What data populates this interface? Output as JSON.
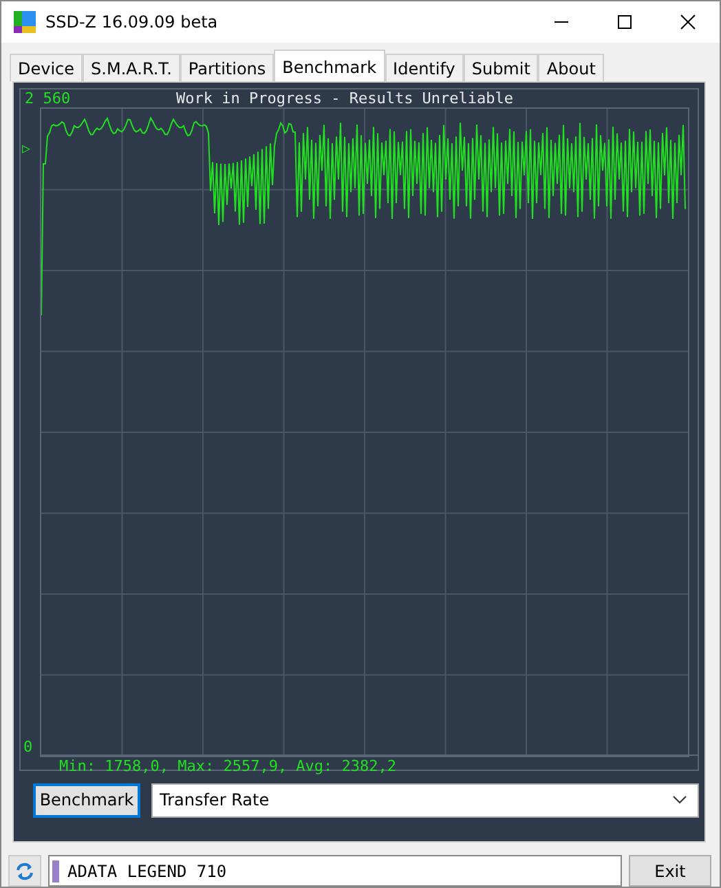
{
  "window": {
    "title": "SSD-Z 16.09.09 beta"
  },
  "tabs": [
    {
      "label": "Device",
      "selected": false
    },
    {
      "label": "S.M.A.R.T.",
      "selected": false
    },
    {
      "label": "Partitions",
      "selected": false
    },
    {
      "label": "Benchmark",
      "selected": true
    },
    {
      "label": "Identify",
      "selected": false
    },
    {
      "label": "Submit",
      "selected": false
    },
    {
      "label": "About",
      "selected": false
    }
  ],
  "graph": {
    "title": "Work in Progress - Results Unreliable",
    "y_max_label": "2 560",
    "y_min_label": "0",
    "marker": "▷",
    "stats": "Min: 1758,0, Max: 2557,9, Avg: 2382,2"
  },
  "controls": {
    "button": "Benchmark",
    "mode": "Transfer Rate"
  },
  "status_bar": {
    "drive": "ADATA LEGEND 710",
    "exit": "Exit"
  }
}
